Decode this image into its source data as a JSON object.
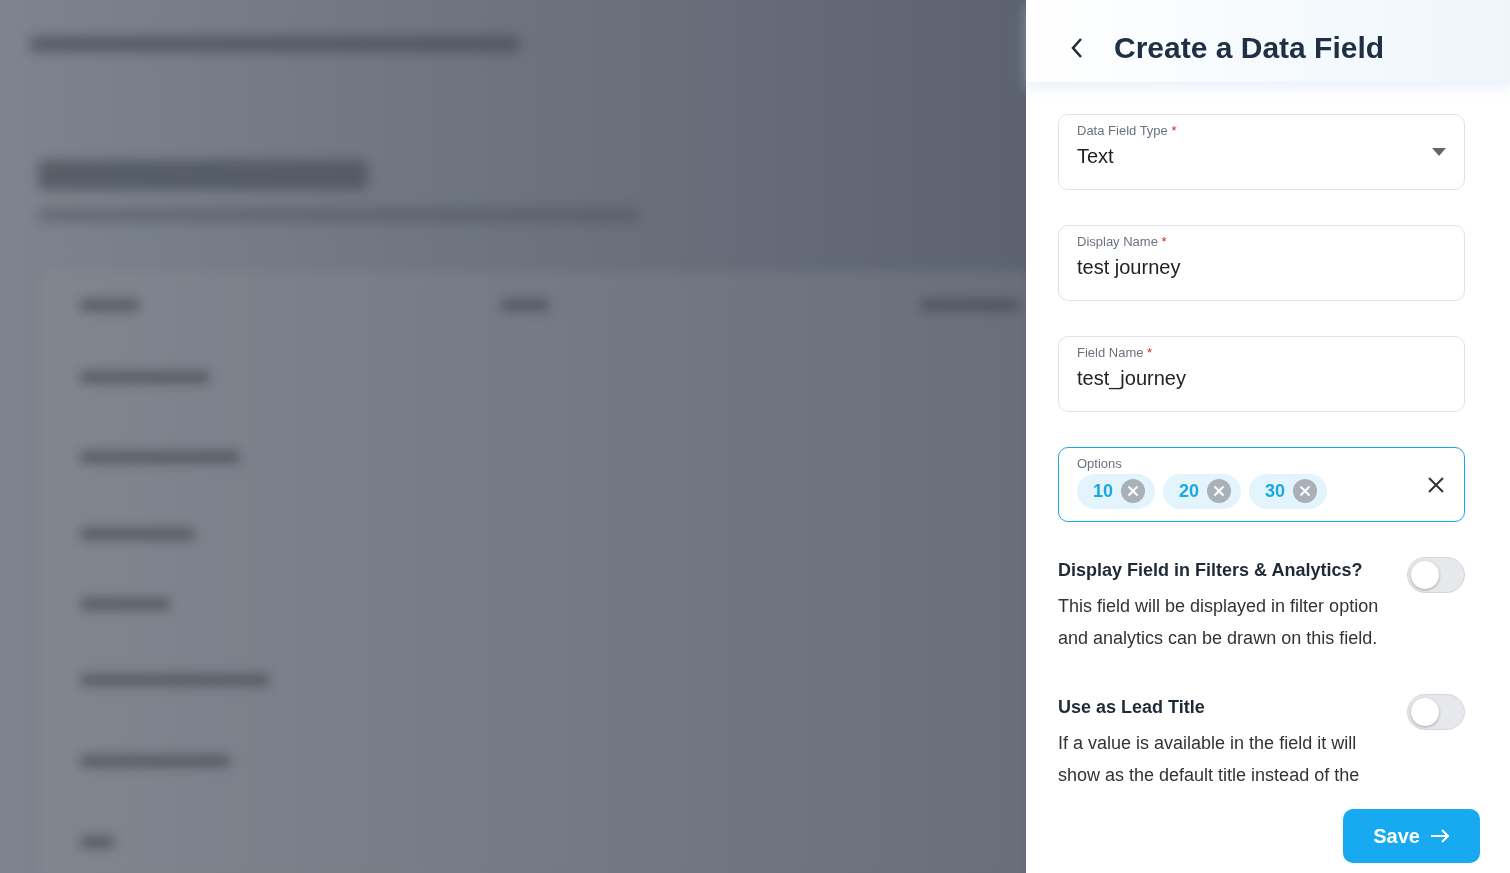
{
  "panel": {
    "title": "Create a Data Field",
    "fields": [
      {
        "kind": "select",
        "label": "Data Field Type",
        "required_mark": "*",
        "focused": false,
        "value": "Text"
      },
      {
        "kind": "text",
        "label": "Display Name",
        "required_mark": "*",
        "focused": false,
        "value": "test journey"
      },
      {
        "kind": "text",
        "label": "Field Name",
        "required_mark": "*",
        "focused": false,
        "value": "test_journey"
      },
      {
        "kind": "chips",
        "label": "Options",
        "focused": true,
        "chips": [
          "10",
          "20",
          "30"
        ]
      }
    ],
    "toggles": [
      {
        "title": "Display Field in Filters & Analytics?",
        "description": "This field will be displayed in filter option and analytics can be drawn on this field.",
        "on": false
      },
      {
        "title": "Use as Lead Title",
        "description": "If a value is available in the field it will show as the default title instead of the",
        "on": false
      }
    ],
    "save_button": "Save"
  }
}
